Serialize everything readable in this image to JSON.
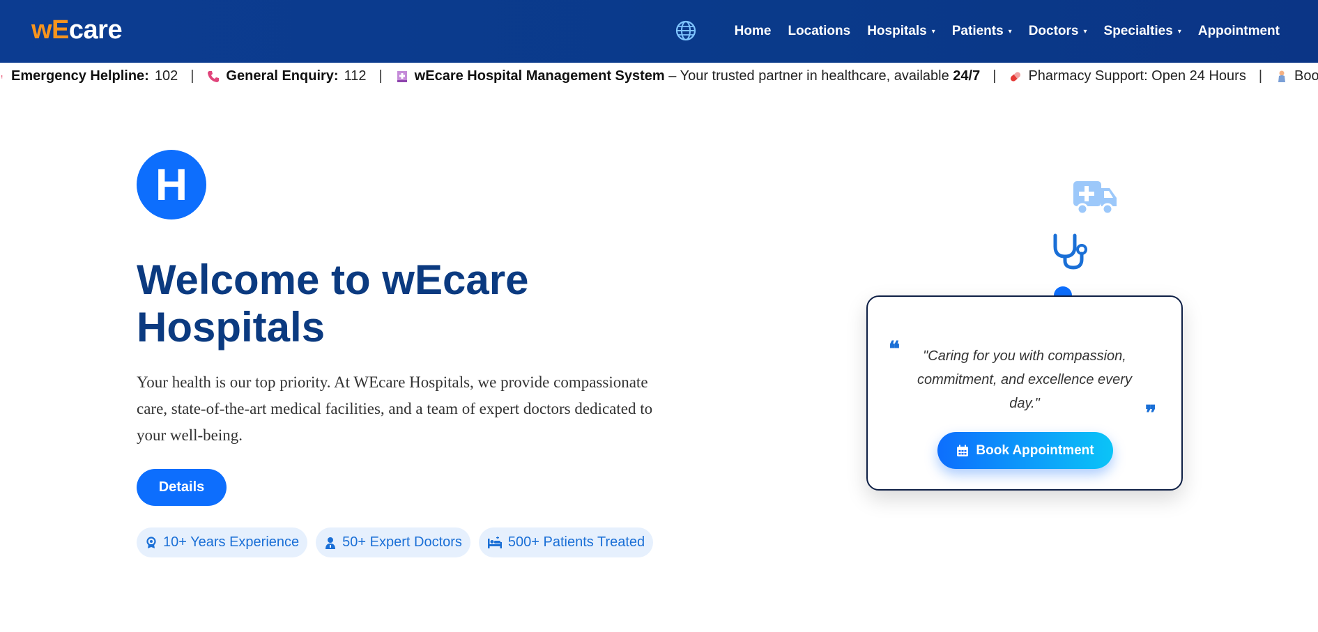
{
  "navbar": {
    "brand_part1": "wE",
    "brand_part2": "care",
    "globe_icon": "globe-icon",
    "items": [
      {
        "label": "Home",
        "dropdown": false
      },
      {
        "label": "Locations",
        "dropdown": false
      },
      {
        "label": "Hospitals",
        "dropdown": true
      },
      {
        "label": "Patients",
        "dropdown": true
      },
      {
        "label": "Doctors",
        "dropdown": true
      },
      {
        "label": "Specialties",
        "dropdown": true
      },
      {
        "label": "Appointment",
        "dropdown": false
      }
    ],
    "caret": "▾"
  },
  "ticker": {
    "items": [
      {
        "icon": "exclamation-icon",
        "bold": "Emergency Helpline:",
        "text": " 102"
      },
      {
        "icon": "phone-icon",
        "bold": "General Enquiry:",
        "text": " 112"
      },
      {
        "icon": "hospital-icon",
        "bold": "wEcare Hospital Management System",
        "text": " – Your trusted partner in healthcare, available ",
        "bold2": "24/7"
      },
      {
        "icon": "pill-icon",
        "bold": "",
        "text": "Pharmacy Support: Open 24 Hours"
      },
      {
        "icon": "person-icon",
        "bold": "",
        "text": "Book a"
      }
    ],
    "separator": "|"
  },
  "hero": {
    "logo_letter": "H",
    "title": "Welcome to wEcare Hospitals",
    "description": "Your health is our top priority. At WEcare Hospitals, we provide compassionate care, state-of-the-art medical facilities, and a team of expert doctors dedicated to your well-being.",
    "details_button": "Details",
    "badges": [
      {
        "icon": "award-icon",
        "label": "10+ Years Experience"
      },
      {
        "icon": "doctor-icon",
        "label": "50+ Expert Doctors"
      },
      {
        "icon": "bed-icon",
        "label": "500+ Patients Treated"
      }
    ]
  },
  "quote_card": {
    "quote": "\"Caring for you with compassion, commitment, and excellence every day.\"",
    "book_button": "Book Appointment"
  },
  "colors": {
    "navbar": "#0c3c91",
    "accent": "#0d6efd",
    "brand_orange": "#f7941d",
    "title": "#0b3a80"
  }
}
